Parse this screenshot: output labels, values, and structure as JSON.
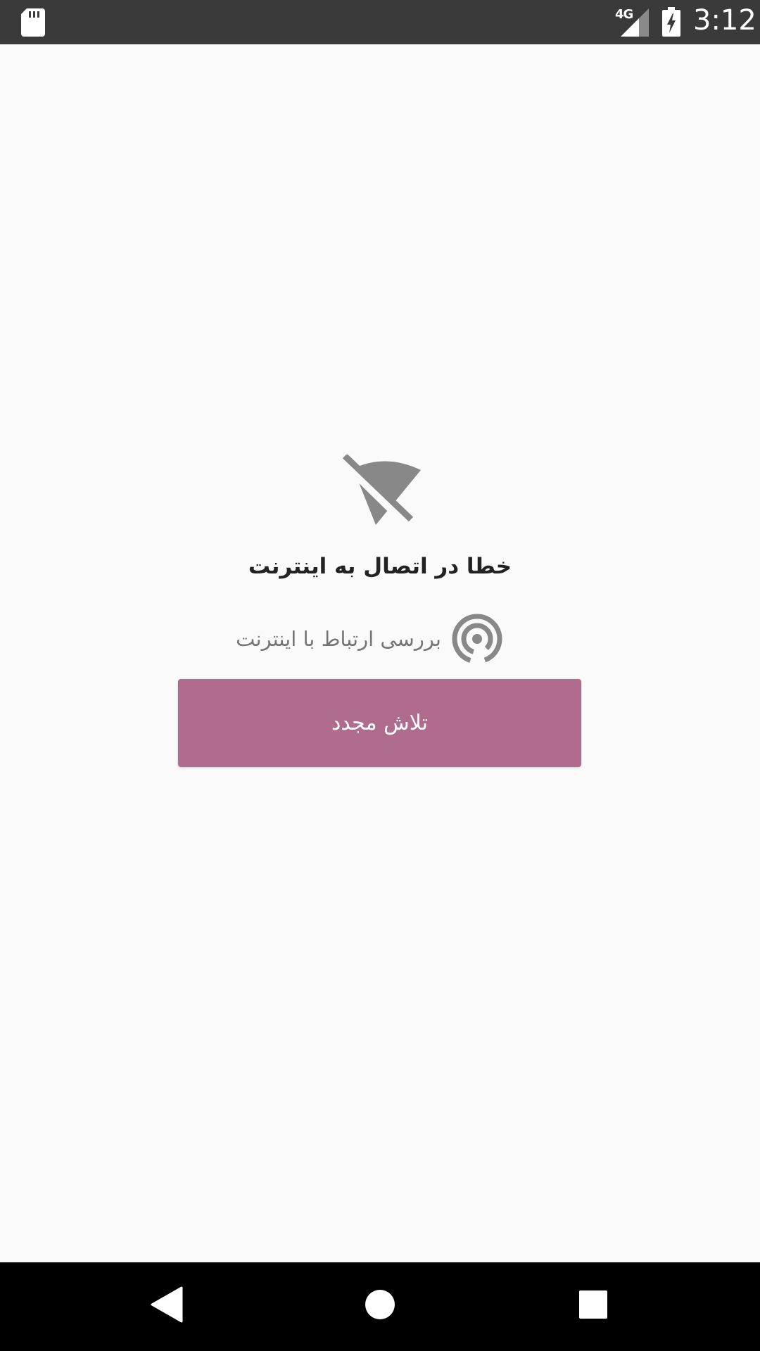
{
  "status_bar": {
    "network_type": "4G",
    "time": "3:12",
    "icons": [
      "sd-card-icon",
      "signal-icon",
      "battery-charging-icon"
    ]
  },
  "error": {
    "icon": "wifi-off-icon",
    "title": "خطا در اتصال به اینترنت",
    "check_icon": "wireless-check-icon",
    "check_label": "بررسی ارتباط با اینترنت"
  },
  "actions": {
    "retry_label": "تلاش مجدد"
  },
  "nav_bar": {
    "icons": [
      "back-icon",
      "home-icon",
      "recents-icon"
    ]
  },
  "colors": {
    "status_bar": "#3a3a3a",
    "background": "#fafafa",
    "accent": "#b06c8c",
    "icon_gray": "#888888",
    "nav_bar": "#000000"
  }
}
